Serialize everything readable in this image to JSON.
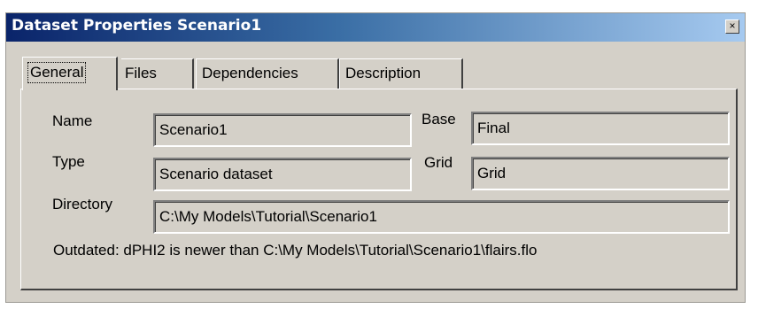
{
  "window": {
    "title": "Dataset Properties Scenario1",
    "close_label": "×"
  },
  "tabs": [
    {
      "label": "General"
    },
    {
      "label": "Files"
    },
    {
      "label": "Dependencies"
    },
    {
      "label": "Description"
    }
  ],
  "general": {
    "name_label": "Name",
    "name_value": "Scenario1",
    "base_label": "Base",
    "base_value": "Final",
    "type_label": "Type",
    "type_value": "Scenario dataset",
    "grid_label": "Grid",
    "grid_value": "Grid",
    "directory_label": "Directory",
    "directory_value": "C:\\My Models\\Tutorial\\Scenario1",
    "status_text": "Outdated: dPHI2 is newer than C:\\My Models\\Tutorial\\Scenario1\\flairs.flo"
  },
  "colors": {
    "title_gradient_start": "#0a246a",
    "title_gradient_end": "#a6caf0",
    "face": "#d4d0c8"
  },
  "icons": {
    "close": "close-icon"
  }
}
